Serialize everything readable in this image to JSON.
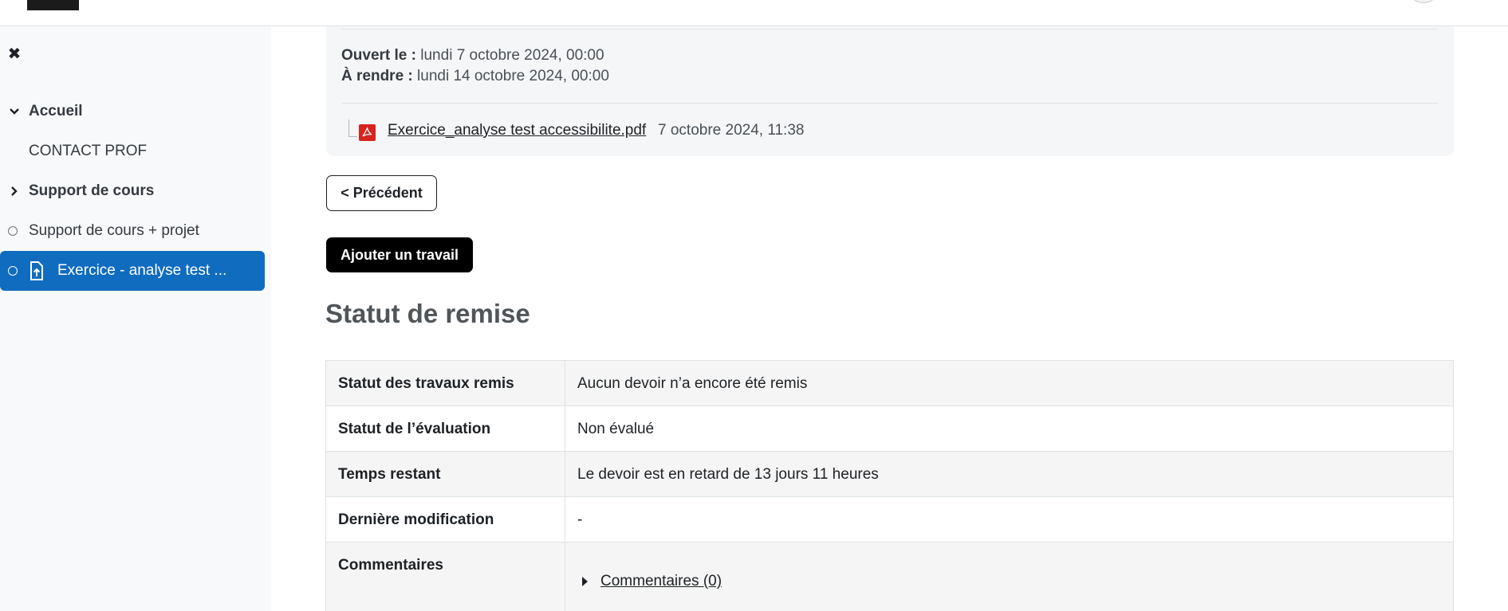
{
  "drawer": {
    "close_glyph": "✖",
    "items": [
      {
        "label": "Accueil",
        "type": "section",
        "icon": "chevron-down-icon"
      },
      {
        "label": "CONTACT PROF",
        "type": "link"
      },
      {
        "label": "Support de cours",
        "type": "section",
        "icon": "chevron-right-icon"
      },
      {
        "label": "Support de cours + projet",
        "type": "activity"
      },
      {
        "label": "Exercice - analyse test ...",
        "type": "activity-active",
        "icon": "file-upload-icon"
      }
    ]
  },
  "dates": {
    "opened_label": "Ouvert le :",
    "opened_value": "lundi 7 octobre 2024, 00:00",
    "due_label": "À rendre :",
    "due_value": "lundi 14 octobre 2024, 00:00"
  },
  "attachment": {
    "icon": "pdf-icon",
    "filename": "Exercice_analyse test accessibilite.pdf",
    "date": "7 octobre 2024, 11:38"
  },
  "buttons": {
    "previous": "< Précédent",
    "add_work": "Ajouter un travail"
  },
  "section_title": "Statut de remise",
  "status_table": {
    "rows": [
      {
        "key": "Statut des travaux remis",
        "value": "Aucun devoir n’a encore été remis"
      },
      {
        "key": "Statut de l’évaluation",
        "value": "Non évalué"
      },
      {
        "key": "Temps restant",
        "value": "Le devoir est en retard de 13 jours 11 heures"
      },
      {
        "key": "Dernière modification",
        "value": "-"
      },
      {
        "key": "Commentaires",
        "value": "Commentaires (0)"
      }
    ]
  },
  "colors": {
    "accent": "#0f6cbf",
    "late": "#ca3120",
    "drawer_bg": "#f8f9fa"
  }
}
